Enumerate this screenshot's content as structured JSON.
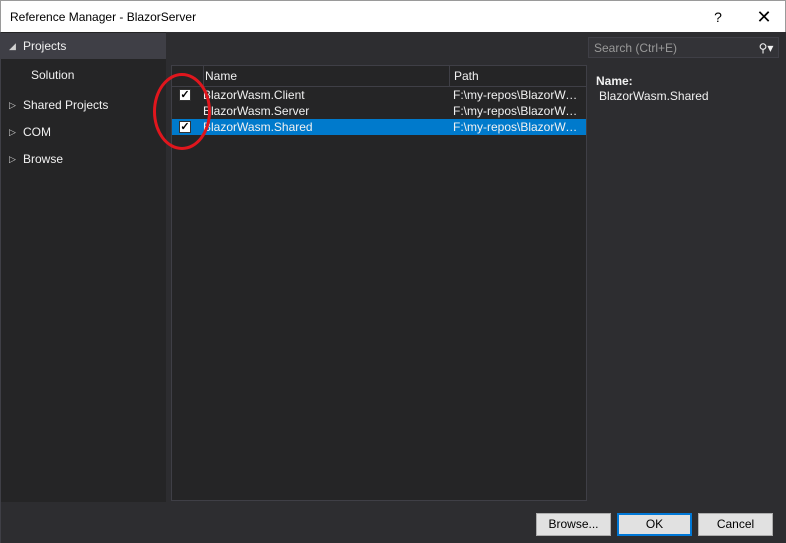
{
  "window": {
    "title": "Reference Manager - BlazorServer",
    "help_label": "?",
    "close_label": "✕"
  },
  "nav": {
    "items": [
      {
        "label": "Projects",
        "arrow": "◢"
      },
      {
        "label": "Solution"
      },
      {
        "label": "Shared Projects",
        "arrow": "▷"
      },
      {
        "label": "COM",
        "arrow": "▷"
      },
      {
        "label": "Browse",
        "arrow": "▷"
      }
    ]
  },
  "list": {
    "columns": {
      "name": "Name",
      "path": "Path"
    },
    "rows": [
      {
        "name": "BlazorWasm.Client",
        "path": "F:\\my-repos\\BlazorWasm\\Client",
        "checked": true,
        "check_mark": "✓"
      },
      {
        "name": "BlazorWasm.Server",
        "path": "F:\\my-repos\\BlazorWasm\\Server",
        "checked": false,
        "check_mark": ""
      },
      {
        "name": "BlazorWasm.Shared",
        "path": "F:\\my-repos\\BlazorWasm\\Shared",
        "checked": true,
        "check_mark": "✓"
      }
    ]
  },
  "search": {
    "placeholder": "Search (Ctrl+E)",
    "icon": "search-icon",
    "icon_glyph": "⚲▾"
  },
  "details": {
    "label": "Name:",
    "value": "BlazorWasm.Shared"
  },
  "buttons": {
    "browse": "Browse...",
    "ok": "OK",
    "cancel": "Cancel"
  },
  "colors": {
    "accent": "#007acc",
    "highlight_ring": "#e0161d"
  }
}
